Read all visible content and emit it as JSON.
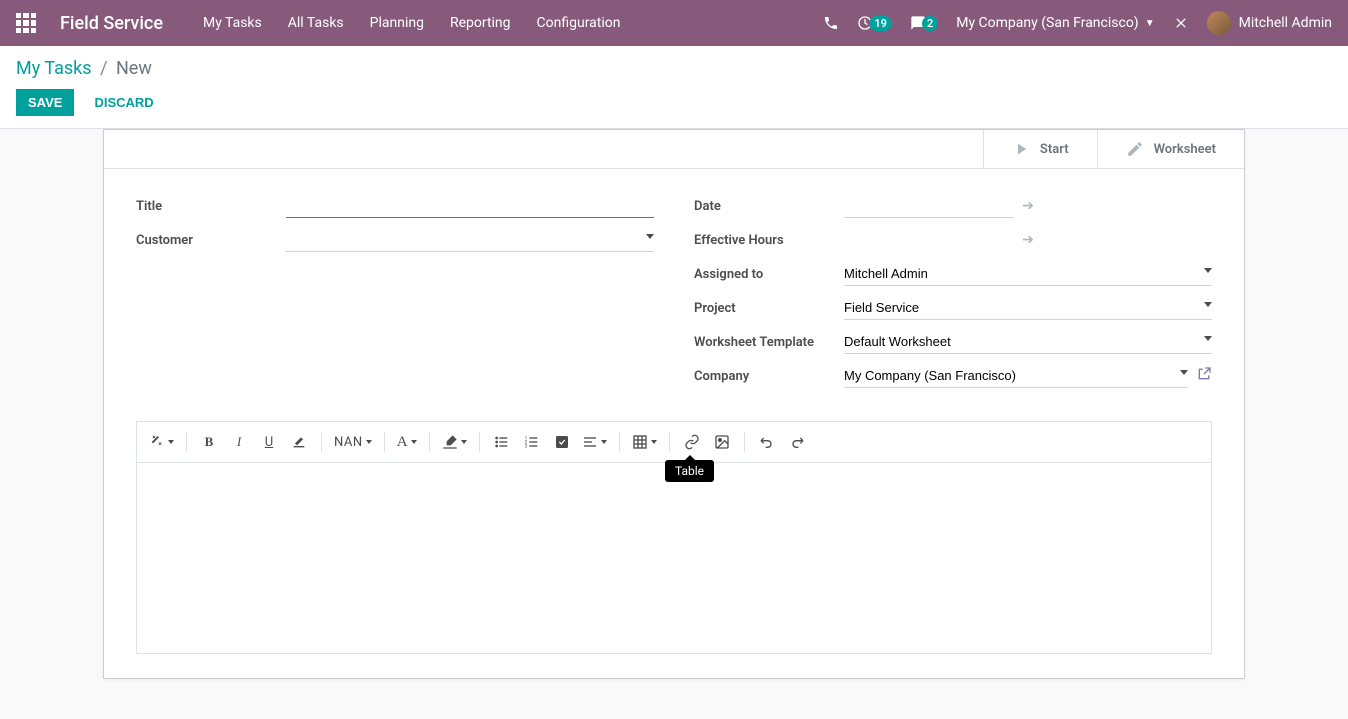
{
  "navbar": {
    "brand": "Field Service",
    "menu": [
      "My Tasks",
      "All Tasks",
      "Planning",
      "Reporting",
      "Configuration"
    ],
    "clock_badge": "19",
    "chat_badge": "2",
    "company": "My Company (San Francisco)",
    "user": "Mitchell Admin"
  },
  "breadcrumb": {
    "parent": "My Tasks",
    "current": "New"
  },
  "buttons": {
    "save": "Save",
    "discard": "Discard"
  },
  "status": {
    "start": "Start",
    "worksheet": "Worksheet"
  },
  "form": {
    "left": {
      "title_label": "Title",
      "title_value": "",
      "customer_label": "Customer",
      "customer_value": ""
    },
    "right": {
      "date_label": "Date",
      "date_from": "",
      "date_to": "",
      "eff_hours_label": "Effective Hours",
      "eff_hours_value": "",
      "assigned_label": "Assigned to",
      "assigned_value": "Mitchell Admin",
      "project_label": "Project",
      "project_value": "Field Service",
      "wtemplate_label": "Worksheet Template",
      "wtemplate_value": "Default Worksheet",
      "company_label": "Company",
      "company_value": "My Company (San Francisco)"
    }
  },
  "toolbar": {
    "font_size": "NAN",
    "tooltip": "Table"
  }
}
